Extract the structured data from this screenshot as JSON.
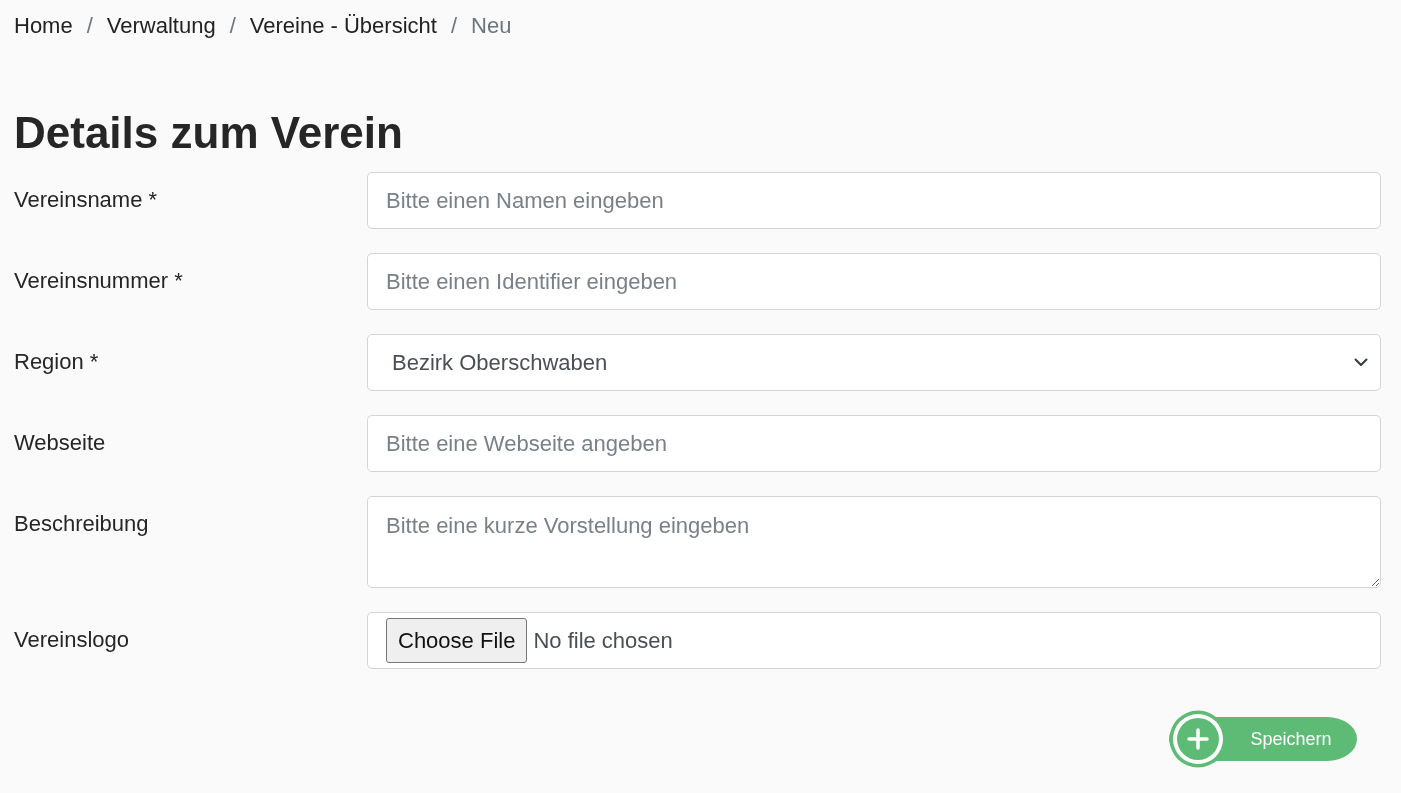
{
  "breadcrumb": [
    {
      "label": "Home",
      "current": false
    },
    {
      "label": "Verwaltung",
      "current": false
    },
    {
      "label": "Vereine - Übersicht",
      "current": false
    },
    {
      "label": "Neu",
      "current": true
    }
  ],
  "breadcrumb_separator": "/",
  "heading": "Details zum Verein",
  "fields": [
    {
      "kind": "text",
      "label": "Vereinsname *",
      "placeholder": "Bitte einen Namen eingeben"
    },
    {
      "kind": "text",
      "label": "Vereinsnummer *",
      "placeholder": "Bitte einen Identifier eingeben"
    },
    {
      "kind": "select",
      "label": "Region *",
      "value": "Bezirk Oberschwaben"
    },
    {
      "kind": "text",
      "label": "Webseite",
      "placeholder": "Bitte eine Webseite angeben"
    },
    {
      "kind": "textarea",
      "label": "Beschreibung",
      "placeholder": "Bitte eine kurze Vorstellung eingeben"
    },
    {
      "kind": "file",
      "label": "Vereinslogo",
      "button": "Choose File",
      "status": "No file chosen"
    }
  ],
  "save_button": {
    "label": "Speichern"
  }
}
